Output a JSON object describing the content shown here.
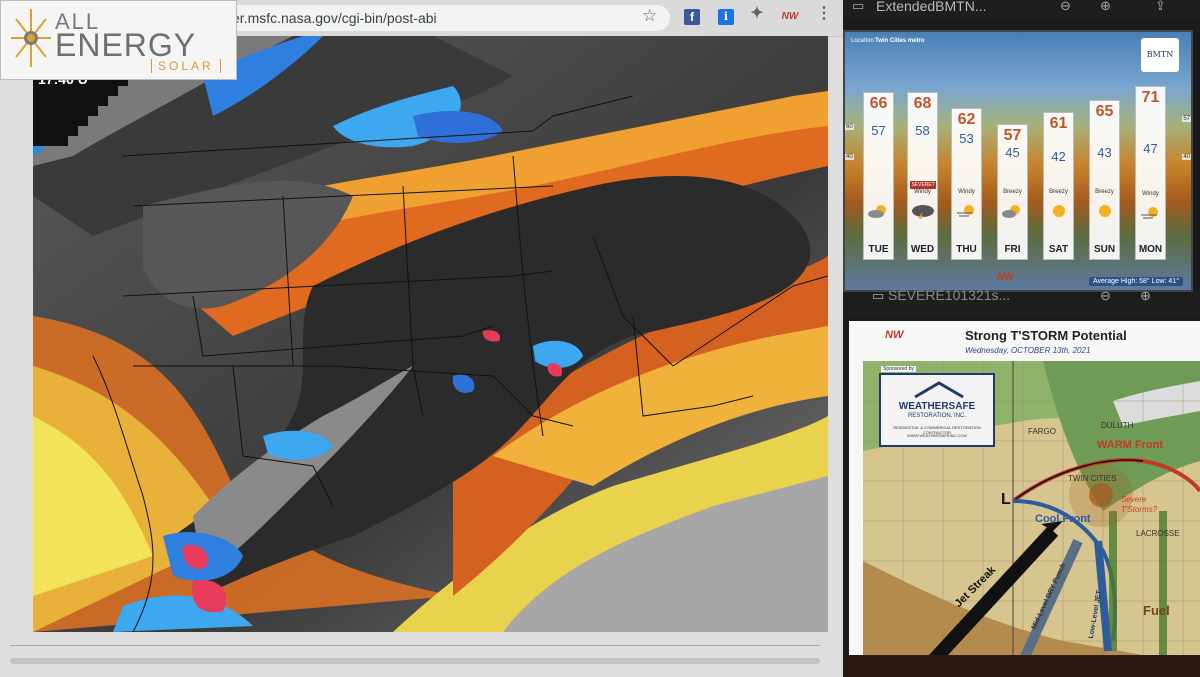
{
  "browser": {
    "url": "er.msfc.nasa.gov/cgi-bin/post-abi",
    "timestamp_overlay": "17:46 U"
  },
  "logo": {
    "line1": "ALL",
    "line2": "ENERGY",
    "line3": "SOLAR"
  },
  "right_panel": {
    "tab1_title": "ExtendedBMTN...",
    "tab2_title": "SEVERE101321s..."
  },
  "forecast": {
    "location_label": "Location:",
    "location": "Twin Cities metro",
    "station_logo": "BMTN",
    "guide_labels": [
      "60",
      "40"
    ],
    "guide_right": [
      "57",
      "40"
    ],
    "days": [
      {
        "day": "TUE",
        "high": "66",
        "low": "57",
        "cond": ""
      },
      {
        "day": "WED",
        "high": "68",
        "low": "58",
        "cond": "Windy",
        "alert": "SEVERE?"
      },
      {
        "day": "THU",
        "high": "62",
        "low": "53",
        "cond": "Windy"
      },
      {
        "day": "FRI",
        "high": "57",
        "low": "45",
        "cond": "Breezy"
      },
      {
        "day": "SAT",
        "high": "61",
        "low": "42",
        "cond": "Breezy"
      },
      {
        "day": "SUN",
        "high": "65",
        "low": "43",
        "cond": "Breezy"
      },
      {
        "day": "MON",
        "high": "71",
        "low": "47",
        "cond": "Windy"
      }
    ],
    "average": "Average High: 58° Low: 41°",
    "footer_logo": "NW"
  },
  "storm": {
    "title": "Strong T'STORM Potential",
    "subtitle": "Wednesday, OCTOBER 13th, 2021",
    "logo": "NW",
    "sponsor": {
      "label": "Sponsored by",
      "name": "WEATHERSAFE",
      "sub": "RESTORATION, INC.",
      "line": "RESIDENTIAL & COMMERCIAL RESTORATION CONTRACTOR",
      "url": "WWW.WEATHERSAFEINC.COM"
    },
    "cities": {
      "fargo": "FARGO",
      "duluth": "DULUTH",
      "twin_cities": "TWIN CITIES",
      "lacrosse": "LACROSSE"
    },
    "labels": {
      "warm_front": "WARM Front",
      "cool_front": "Cool Front",
      "jet_streak": "Jet Streak",
      "mid_level": "Mid-Level DRY Punch",
      "low_level": "Low-Level JET",
      "fuel": "Fuel",
      "severe": "Severe",
      "tstorms": "T'Storms?",
      "low_center": "L"
    }
  },
  "colors": {
    "warm": "#c23b22",
    "cool": "#2e5b9b",
    "accent": "#d89a2b"
  }
}
